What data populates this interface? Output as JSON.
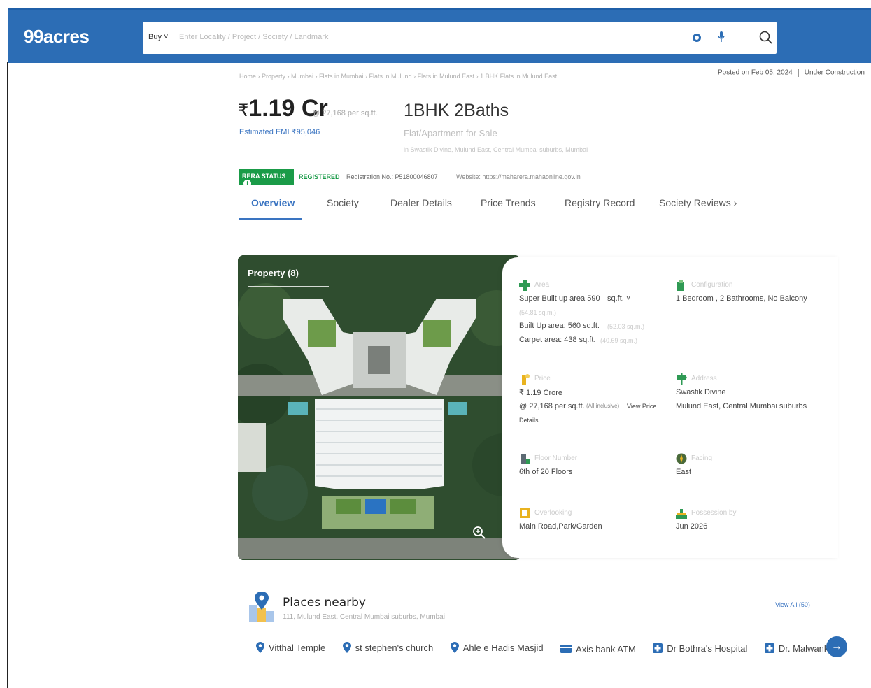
{
  "header": {
    "logo": "99acres",
    "search_mode": "Buy ˅",
    "search_placeholder": "Enter Locality / Project / Society / Landmark"
  },
  "breadcrumb": "Home › Property › Mumbai › Flats in Mumbai › Flats in Mulund › Flats in Mulund East › 1 BHK Flats in Mulund East",
  "posted": {
    "date": "Posted on Feb 05, 2024",
    "status": "Under Construction"
  },
  "listing": {
    "price_symbol": "₹",
    "price": "1.19 Cr",
    "price_per_sqft": "@ 27,168 per sq.ft.",
    "emi": "Estimated EMI ₹95,046",
    "title": "1BHK 2Baths",
    "subtitle": "Flat/Apartment for Sale",
    "address": "in Swastik Divine, Mulund East, Central Mumbai suburbs, Mumbai"
  },
  "rera": {
    "badge": "RERA STATUS",
    "status": "REGISTERED",
    "registration": "Registration No.: P51800046807",
    "website": "Website: https://maharera.mahaonline.gov.in"
  },
  "tabs": [
    {
      "label": "Overview"
    },
    {
      "label": "Society"
    },
    {
      "label": "Dealer Details"
    },
    {
      "label": "Price Trends"
    },
    {
      "label": "Registry Record"
    },
    {
      "label": "Society Reviews  ›"
    }
  ],
  "photo": {
    "title": "Property (8)"
  },
  "details": {
    "area": {
      "label": "Area",
      "super_built": "Super Built up area 590",
      "unit": "sq.ft. ˅",
      "unit_note": "(54.81 sq.m.)",
      "built_up": "Built Up area: 560 sq.ft.",
      "built_up_note": "(52.03 sq.m.)",
      "carpet": "Carpet area: 438 sq.ft.",
      "carpet_note": "(40.69 sq.m.)"
    },
    "configuration": {
      "label": "Configuration",
      "value": "1 Bedroom , 2 Bathrooms, No Balcony"
    },
    "price": {
      "label": "Price",
      "value": "₹ 1.19 Crore",
      "per_sqft": "@ 27,168 per sq.ft.",
      "note": "(All inclusive)",
      "link": "View Price",
      "link2": "Details"
    },
    "address": {
      "label": "Address",
      "line1": "Swastik Divine",
      "line2": "Mulund East, Central Mumbai suburbs"
    },
    "floor": {
      "label": "Floor Number",
      "value": "6th  of 20 Floors"
    },
    "facing": {
      "label": "Facing",
      "value": "East"
    },
    "overlooking": {
      "label": "Overlooking",
      "value": "Main Road,Park/Garden"
    },
    "possession": {
      "label": "Possession by",
      "value": "Jun 2026"
    }
  },
  "places": {
    "title": "Places nearby",
    "address": "111, Mulund East, Central Mumbai suburbs, Mumbai",
    "view_all": "View All (50)",
    "items": [
      {
        "name": "Vitthal Temple",
        "icon": "pin-icon"
      },
      {
        "name": "st stephen's church",
        "icon": "pin-icon"
      },
      {
        "name": "Ahle e Hadis Masjid",
        "icon": "pin-icon"
      },
      {
        "name": "Axis bank ATM",
        "icon": "atm-icon"
      },
      {
        "name": "Dr Bothra's Hospital",
        "icon": "hospital-icon"
      },
      {
        "name": "Dr. Malwankar",
        "icon": "hospital-icon"
      }
    ]
  },
  "colors": {
    "brand": "#2c6db5",
    "link": "#3a74c1",
    "rera_green": "#1a9b48"
  }
}
